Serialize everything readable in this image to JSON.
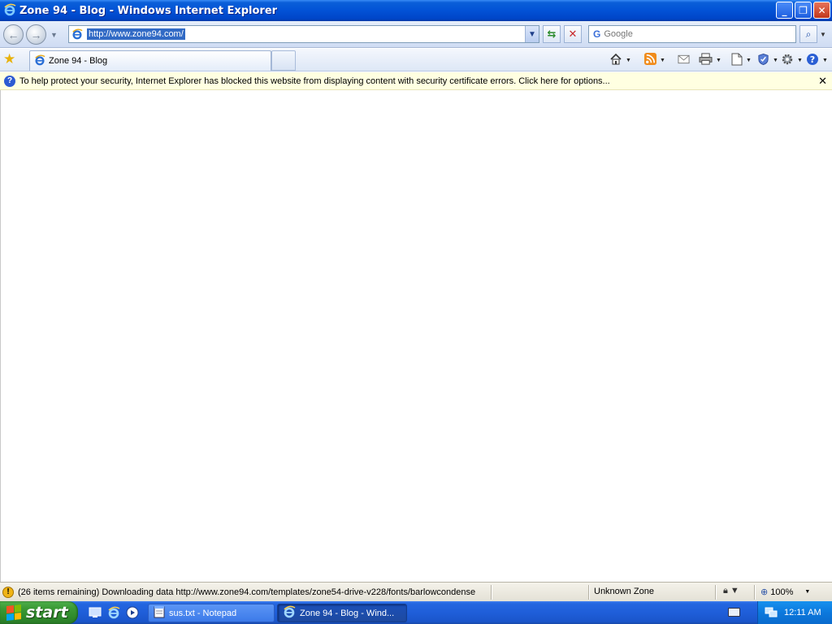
{
  "window": {
    "title": "Zone 94 - Blog - Windows Internet Explorer",
    "minimize_glyph": "_",
    "maximize_glyph": "❐",
    "close_glyph": "✕"
  },
  "navigation": {
    "back_glyph": "←",
    "forward_glyph": "→",
    "address_url": "http://www.zone94.com/",
    "search_placeholder": "Google",
    "search_provider_glyph": "G"
  },
  "tabs": [
    {
      "label": "Zone 94 - Blog",
      "active": true
    }
  ],
  "command_bar": {
    "icons": [
      "home-icon",
      "feeds-icon",
      "read-mail-icon",
      "print-icon",
      "page-icon",
      "safety-icon",
      "tools-icon",
      "help-icon"
    ]
  },
  "info_bar": {
    "message": "To help protect your security, Internet Explorer has blocked this website from displaying content with security certificate errors. Click here for options...",
    "close_glyph": "✕"
  },
  "status_bar": {
    "text": "(26 items remaining) Downloading data http://www.zone94.com/templates/zone54-drive-v228/fonts/barlowcondense",
    "zone": "Unknown Zone",
    "zoom": "100%"
  },
  "taskbar": {
    "start_label": "start",
    "tasks": [
      {
        "label": "sus.txt - Notepad",
        "active": false
      },
      {
        "label": "Zone 94 - Blog - Wind...",
        "active": true
      }
    ],
    "clock": "12:11 AM"
  },
  "colors": {
    "title_bar": "#0252d6",
    "info_bar": "#ffffe1",
    "start_button": "#3b9a35",
    "taskbar": "#1f5ed9",
    "selection": "#316ac5"
  }
}
